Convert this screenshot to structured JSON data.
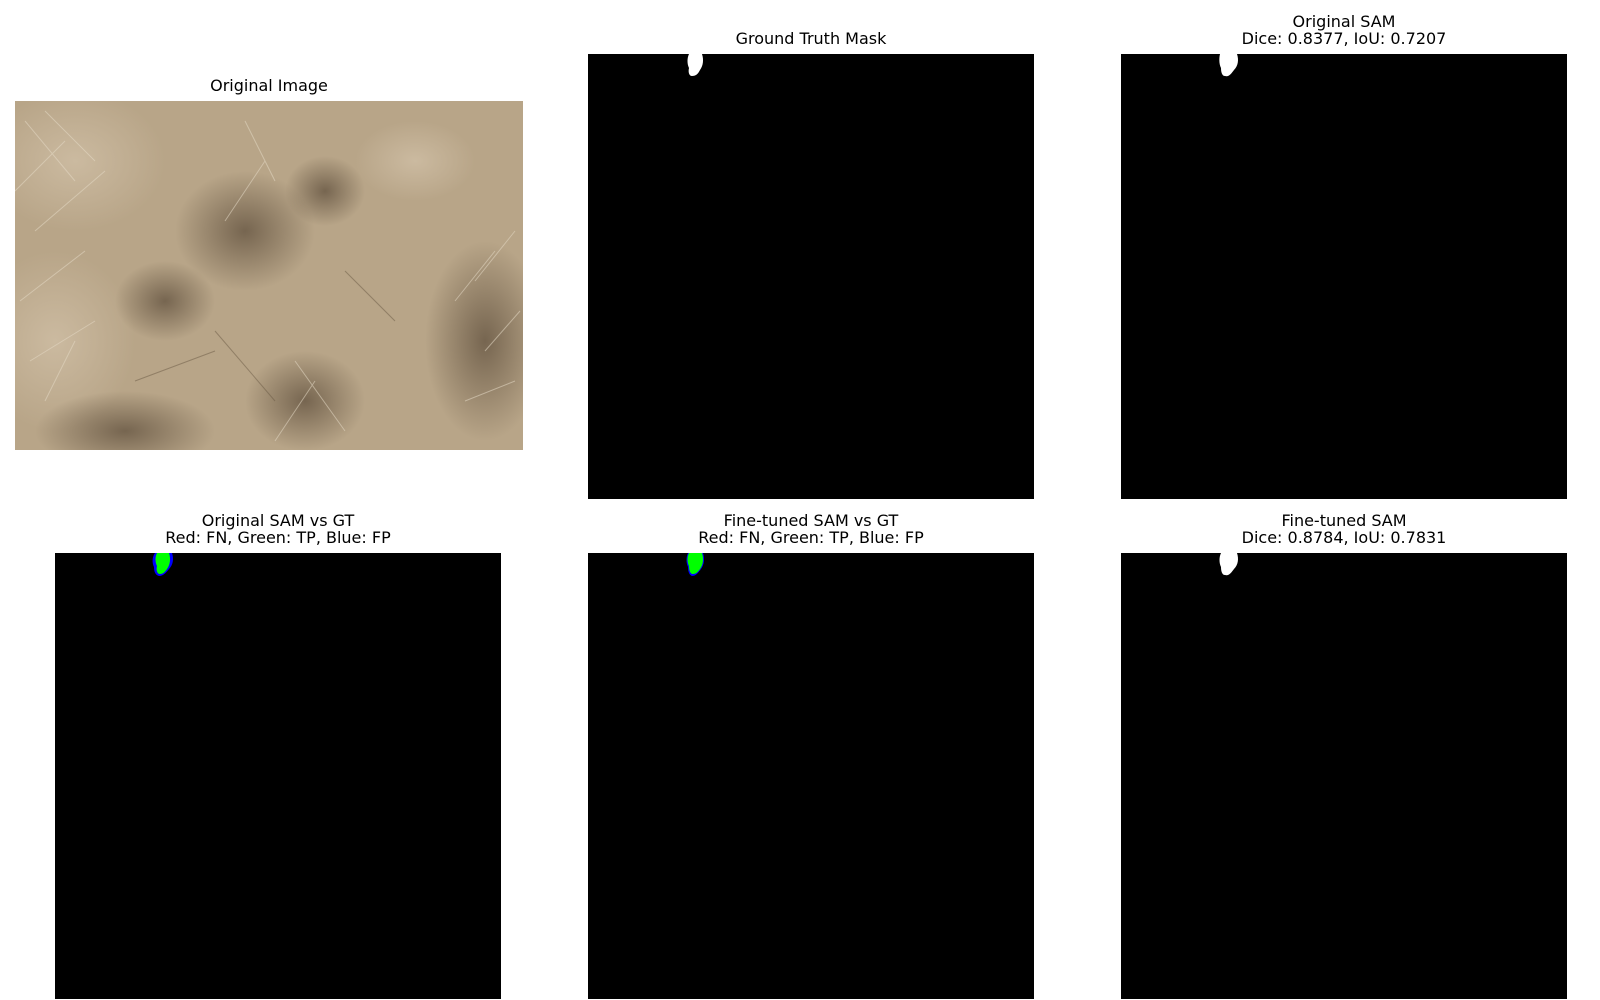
{
  "figure": {
    "panels": [
      {
        "title_lines": [
          "Original Image"
        ],
        "kind": "photo"
      },
      {
        "title_lines": [
          "Ground Truth Mask"
        ],
        "kind": "binary-mask"
      },
      {
        "title_lines": [
          "Original SAM",
          "Dice: 0.8377, IoU: 0.7207"
        ],
        "kind": "binary-mask"
      },
      {
        "title_lines": [
          "Original SAM vs GT",
          "Red: FN, Green: TP, Blue: FP"
        ],
        "kind": "error-overlay"
      },
      {
        "title_lines": [
          "Fine-tuned SAM vs GT",
          "Red: FN, Green: TP, Blue: FP"
        ],
        "kind": "error-overlay"
      },
      {
        "title_lines": [
          "Fine-tuned SAM",
          "Dice: 0.8784, IoU: 0.7831"
        ],
        "kind": "binary-mask"
      }
    ],
    "colors": {
      "background": "#ffffff",
      "mask_background": "#000000",
      "mask_foreground": "#ffffff",
      "true_positive": "#00ff00",
      "false_positive": "#0000ff",
      "false_negative": "#ff0000"
    }
  }
}
